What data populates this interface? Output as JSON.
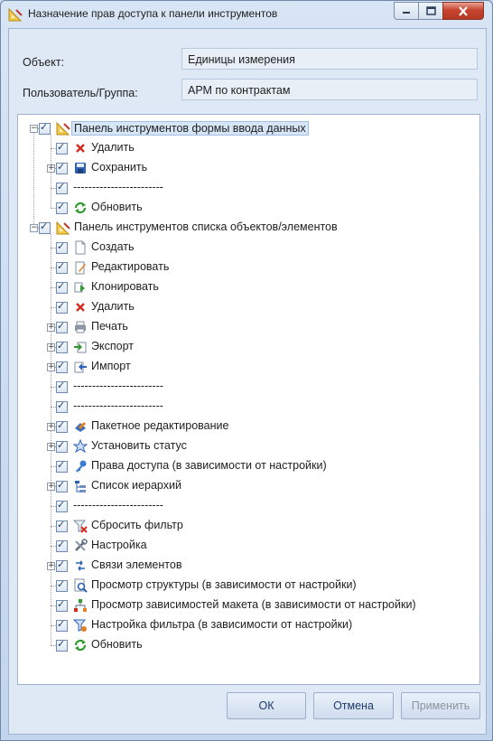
{
  "window": {
    "title": "Назначение прав доступа к панели инструментов"
  },
  "form": {
    "object_label": "Объект:",
    "object_value": "Единицы измерения",
    "user_label": "Пользователь/Группа:",
    "user_value": "АРМ по контрактам"
  },
  "tree": [
    {
      "label": "Панель инструментов формы ввода данных",
      "icon": "toolbar-icon",
      "level": 0,
      "expander": "minus",
      "checked": true,
      "selected": true
    },
    {
      "label": "Удалить",
      "icon": "delete-icon",
      "level": 1,
      "expander": null,
      "checked": true
    },
    {
      "label": "Сохранить",
      "icon": "save-icon",
      "level": 1,
      "expander": "plus",
      "checked": true
    },
    {
      "label": "------------------------",
      "icon": null,
      "level": 1,
      "expander": null,
      "checked": true
    },
    {
      "label": "Обновить",
      "icon": "refresh-icon",
      "level": 1,
      "expander": null,
      "checked": true,
      "last": true
    },
    {
      "label": "Панель инструментов списка объектов/элементов",
      "icon": "toolbar-icon",
      "level": 0,
      "expander": "minus",
      "checked": true
    },
    {
      "label": "Создать",
      "icon": "create-icon",
      "level": 1,
      "expander": null,
      "checked": true
    },
    {
      "label": "Редактировать",
      "icon": "edit-icon",
      "level": 1,
      "expander": null,
      "checked": true
    },
    {
      "label": "Клонировать",
      "icon": "clone-icon",
      "level": 1,
      "expander": null,
      "checked": true
    },
    {
      "label": "Удалить",
      "icon": "delete-icon",
      "level": 1,
      "expander": null,
      "checked": true
    },
    {
      "label": "Печать",
      "icon": "print-icon",
      "level": 1,
      "expander": "plus",
      "checked": true
    },
    {
      "label": "Экспорт",
      "icon": "export-icon",
      "level": 1,
      "expander": "plus",
      "checked": true
    },
    {
      "label": "Импорт",
      "icon": "import-icon",
      "level": 1,
      "expander": "plus",
      "checked": true
    },
    {
      "label": "------------------------",
      "icon": null,
      "level": 1,
      "expander": null,
      "checked": true
    },
    {
      "label": "------------------------",
      "icon": null,
      "level": 1,
      "expander": null,
      "checked": true
    },
    {
      "label": "Пакетное редактирование",
      "icon": "batch-edit-icon",
      "level": 1,
      "expander": "plus",
      "checked": true
    },
    {
      "label": "Установить статус",
      "icon": "set-status-icon",
      "level": 1,
      "expander": "plus",
      "checked": true
    },
    {
      "label": "Права доступа (в зависимости от настройки)",
      "icon": "key-icon",
      "level": 1,
      "expander": null,
      "checked": true
    },
    {
      "label": "Список иерархий",
      "icon": "hierarchy-icon",
      "level": 1,
      "expander": "plus",
      "checked": true
    },
    {
      "label": "------------------------",
      "icon": null,
      "level": 1,
      "expander": null,
      "checked": true
    },
    {
      "label": "Сбросить фильтр",
      "icon": "reset-filter-icon",
      "level": 1,
      "expander": null,
      "checked": true
    },
    {
      "label": "Настройка",
      "icon": "tools-icon",
      "level": 1,
      "expander": null,
      "checked": true
    },
    {
      "label": "Связи элементов",
      "icon": "links-icon",
      "level": 1,
      "expander": "plus",
      "checked": true
    },
    {
      "label": "Просмотр структуры (в зависимости от настройки)",
      "icon": "view-structure-icon",
      "level": 1,
      "expander": null,
      "checked": true
    },
    {
      "label": "Просмотр зависимостей макета (в зависимости от настройки)",
      "icon": "view-dependencies-icon",
      "level": 1,
      "expander": null,
      "checked": true
    },
    {
      "label": "Настройка фильтра (в зависимости от настройки)",
      "icon": "filter-settings-icon",
      "level": 1,
      "expander": null,
      "checked": true
    },
    {
      "label": "Обновить",
      "icon": "refresh-icon",
      "level": 1,
      "expander": null,
      "checked": true,
      "last": true
    }
  ],
  "buttons": {
    "ok": "ОК",
    "cancel": "Отмена",
    "apply": "Применить"
  },
  "colors": {
    "selection": "#d6e6f7",
    "check": "#1c3f6e"
  }
}
